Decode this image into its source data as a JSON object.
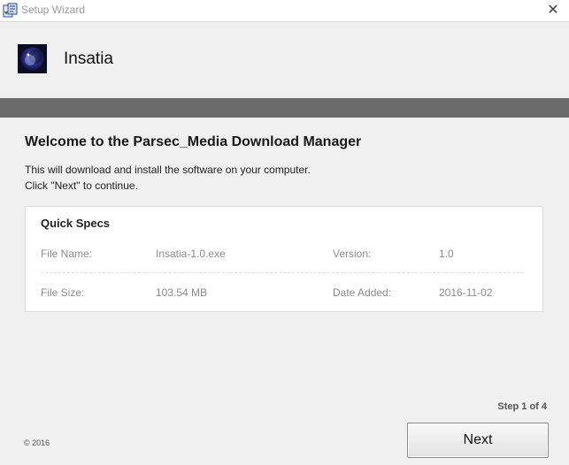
{
  "window": {
    "title": "Setup Wizard",
    "close_glyph": "✕",
    "icon": "installer-app-icon"
  },
  "header": {
    "product_name": "Insatia",
    "logo_icon": "moon-logo-icon"
  },
  "main": {
    "heading": "Welcome to the Parsec_Media Download Manager",
    "description_line1": "This will download and install the software on your computer.",
    "description_line2": "Click \"Next\" to continue."
  },
  "specs": {
    "title": "Quick Specs",
    "rows": [
      [
        {
          "label": "File Name:",
          "value": "Insatia-1.0.exe"
        },
        {
          "label": "Version:",
          "value": "1.0"
        }
      ],
      [
        {
          "label": "File Size:",
          "value": "103.54 MB"
        },
        {
          "label": "Date Added:",
          "value": "2016-11-02"
        }
      ]
    ]
  },
  "footer": {
    "step_text": "Step 1 of 4",
    "copyright": "© 2016",
    "next_label": "Next"
  },
  "colors": {
    "background": "#f0f0f0",
    "stripe": "#6b6b6b",
    "panel": "#ffffff",
    "muted_text": "#8a8a8a"
  }
}
